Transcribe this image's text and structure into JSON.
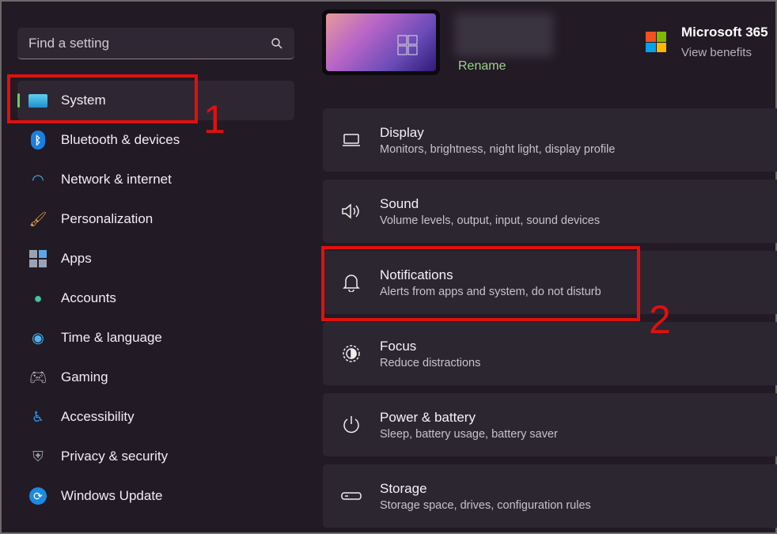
{
  "search": {
    "placeholder": "Find a setting",
    "icon": "search-icon"
  },
  "sidebar": {
    "items": [
      {
        "label": "System",
        "icon": "monitor-icon",
        "active": true
      },
      {
        "label": "Bluetooth & devices",
        "icon": "bluetooth-icon"
      },
      {
        "label": "Network & internet",
        "icon": "wifi-icon"
      },
      {
        "label": "Personalization",
        "icon": "brush-icon"
      },
      {
        "label": "Apps",
        "icon": "apps-icon"
      },
      {
        "label": "Accounts",
        "icon": "person-icon"
      },
      {
        "label": "Time & language",
        "icon": "globe-clock-icon"
      },
      {
        "label": "Gaming",
        "icon": "gamepad-icon"
      },
      {
        "label": "Accessibility",
        "icon": "accessibility-icon"
      },
      {
        "label": "Privacy & security",
        "icon": "shield-icon"
      },
      {
        "label": "Windows Update",
        "icon": "update-icon"
      }
    ]
  },
  "device": {
    "rename": "Rename"
  },
  "m365": {
    "title": "Microsoft 365",
    "subtitle": "View benefits"
  },
  "cards": [
    {
      "title": "Display",
      "subtitle": "Monitors, brightness, night light, display profile",
      "icon": "laptop-icon"
    },
    {
      "title": "Sound",
      "subtitle": "Volume levels, output, input, sound devices",
      "icon": "speaker-icon"
    },
    {
      "title": "Notifications",
      "subtitle": "Alerts from apps and system, do not disturb",
      "icon": "bell-icon"
    },
    {
      "title": "Focus",
      "subtitle": "Reduce distractions",
      "icon": "focus-icon"
    },
    {
      "title": "Power & battery",
      "subtitle": "Sleep, battery usage, battery saver",
      "icon": "power-icon"
    },
    {
      "title": "Storage",
      "subtitle": "Storage space, drives, configuration rules",
      "icon": "storage-icon"
    }
  ],
  "annotations": {
    "one": "1",
    "two": "2"
  },
  "colors": {
    "accent": "#6ccb5f",
    "annotation": "#e0100f",
    "rename": "#9ad58a"
  }
}
